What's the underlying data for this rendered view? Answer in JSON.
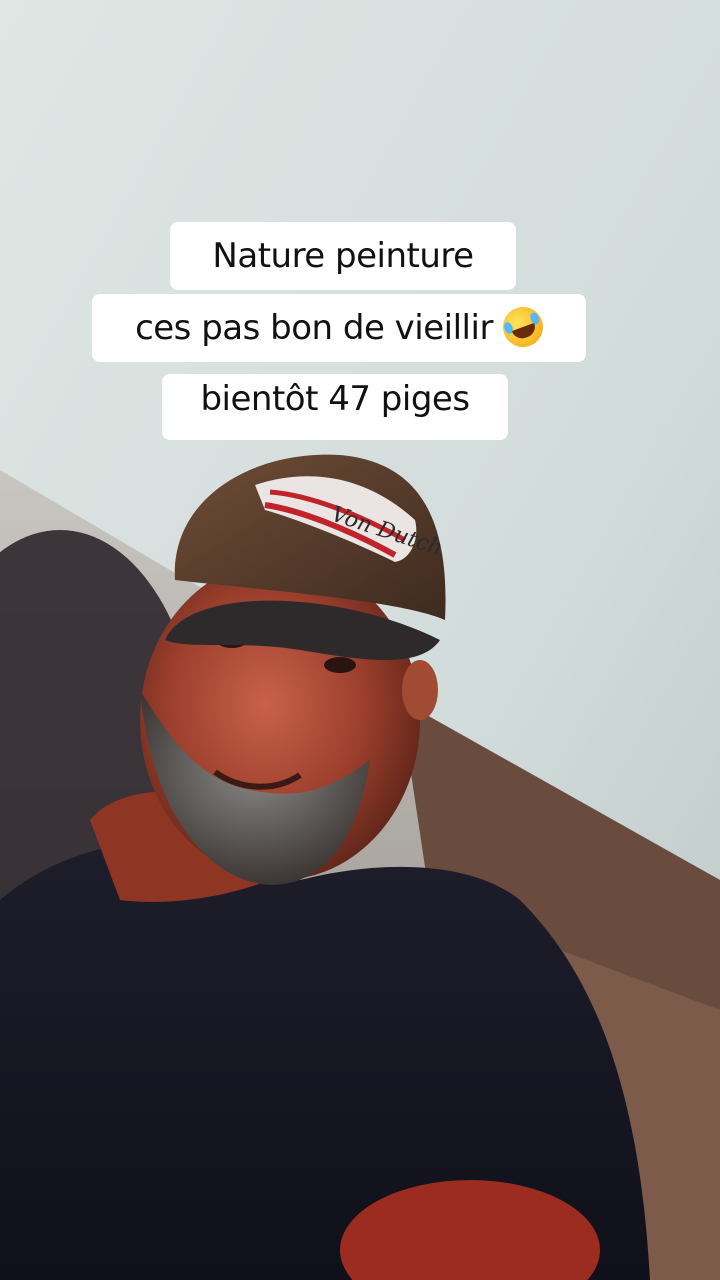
{
  "caption": {
    "line1": "Nature peinture",
    "line2": "ces pas bon de vieillir",
    "line2_emoji": "rolling-on-the-floor-laughing-emoji",
    "line3": "bientôt 47 piges"
  },
  "photo": {
    "description_icon": "selfie-photo",
    "cap_logo_text": "Von Dutch"
  },
  "colors": {
    "wall": "#d4dcdc",
    "shirt": "#141420",
    "caption_bg": "#ffffff",
    "caption_text": "#111111"
  }
}
